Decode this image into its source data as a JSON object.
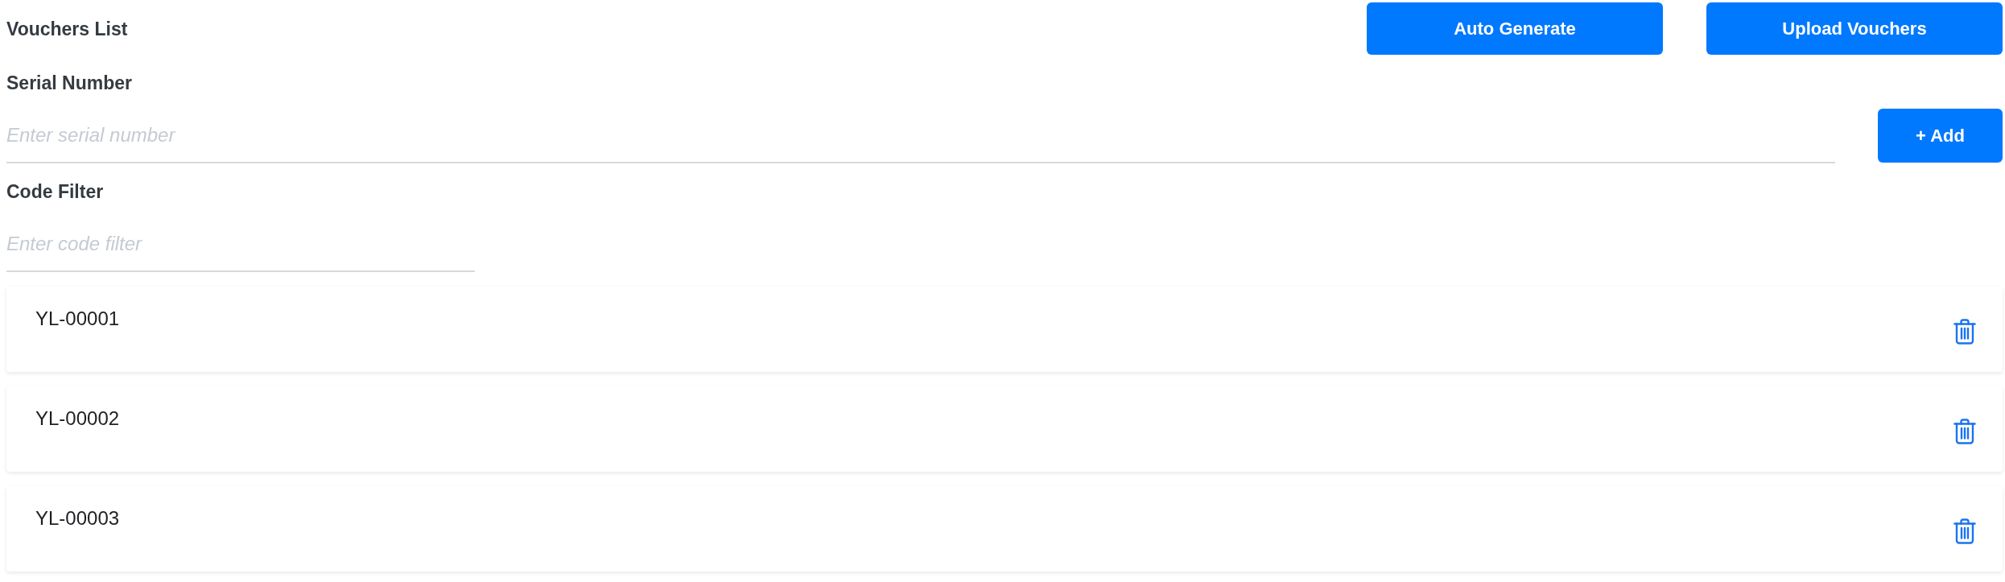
{
  "header": {
    "title": "Vouchers List",
    "buttons": [
      {
        "label": "Auto Generate"
      },
      {
        "label": "Upload Vouchers"
      }
    ]
  },
  "serial_number": {
    "label": "Serial Number",
    "placeholder": "Enter serial number",
    "add_button": "+ Add"
  },
  "code_filter": {
    "label": "Code Filter",
    "placeholder": "Enter code filter"
  },
  "vouchers": [
    {
      "code": "YL-00001"
    },
    {
      "code": "YL-00002"
    },
    {
      "code": "YL-00003"
    }
  ]
}
